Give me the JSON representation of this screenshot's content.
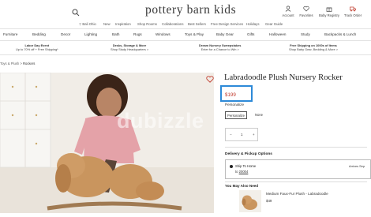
{
  "header": {
    "logo": "pottery barn kids",
    "utilities": [
      {
        "label": "Account",
        "icon": "user-icon"
      },
      {
        "label": "Favorites",
        "icon": "heart-icon"
      },
      {
        "label": "Baby Registry",
        "icon": "gift-icon"
      },
      {
        "label": "Track Order",
        "icon": "truck-icon"
      }
    ],
    "subnav": [
      "Bali Ohio",
      "New",
      "Inspiration",
      "Shop Rooms",
      "Collaborations",
      "Best Sellers",
      "Free Design Services",
      "Holidays",
      "Gear Guide"
    ]
  },
  "categories": [
    "Furniture",
    "Bedding",
    "Decor",
    "Lighting",
    "Bath",
    "Rugs",
    "Windows",
    "Toys & Play",
    "Baby Gear",
    "Gifts",
    "Halloween",
    "Study",
    "Backpacks & Lunch"
  ],
  "promos": [
    {
      "title": "Labor Day Event",
      "text": "Up to 70% off + Free Shipping*"
    },
    {
      "title": "Desks, Storage & More",
      "text": "Shop Study Headquarters >"
    },
    {
      "title": "Dream Nursery Sweepstakes",
      "text": "Enter for a Chance to Win >"
    },
    {
      "title": "Free Shipping on 1000s of Items",
      "text": "Shop Baby Gear, Bedding & More >"
    }
  ],
  "breadcrumb": {
    "parent": "Toys & Plush",
    "separator": ">",
    "current": "Rockers"
  },
  "watermark": {
    "text": "dubizzle"
  },
  "product": {
    "title": "Labradoodle Plush Nursery Rocker",
    "price": "$199",
    "personalize_label": "Personalize",
    "options": [
      "Personalize",
      "None"
    ],
    "quantity": {
      "minus": "−",
      "value": "1",
      "plus": "+"
    }
  },
  "delivery": {
    "heading": "Delivery & Pickup Options",
    "ship_label": "Ship To Home",
    "zip_prefix": "to",
    "zip": "20004",
    "arrives": "Arrives Sep"
  },
  "also_need": {
    "heading": "You May Also Need",
    "item_name": "Medium Faux-Fur Plush - Labradoodle",
    "item_price": "$49"
  },
  "colors": {
    "accent_blue": "#2d8ad8",
    "price_red": "#c0392b"
  }
}
